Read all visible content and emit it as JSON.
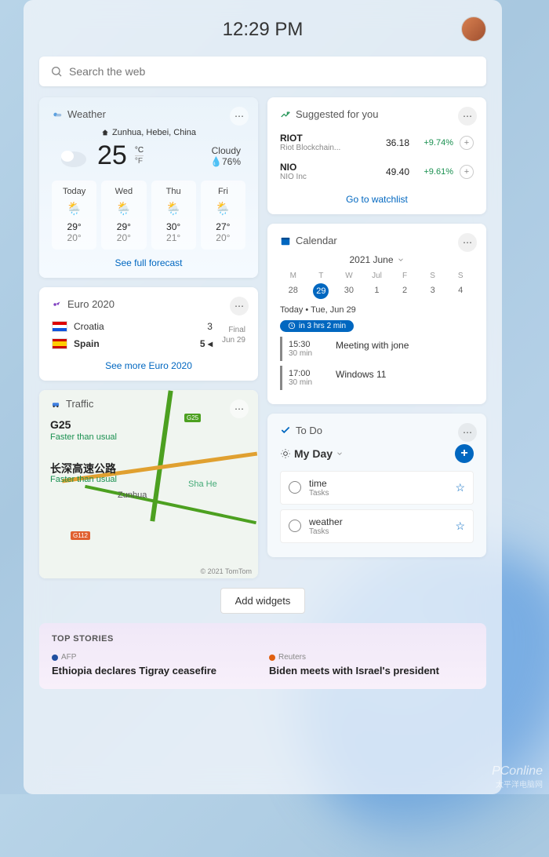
{
  "time": "12:29 PM",
  "search": {
    "placeholder": "Search the web"
  },
  "weather": {
    "title": "Weather",
    "location": "Zunhua, Hebei, China",
    "temp": "25",
    "unit_c": "°C",
    "unit_f": "°F",
    "condition": "Cloudy",
    "humidity": "76%",
    "forecast": [
      {
        "day": "Today",
        "hi": "29°",
        "lo": "20°"
      },
      {
        "day": "Wed",
        "hi": "29°",
        "lo": "20°"
      },
      {
        "day": "Thu",
        "hi": "30°",
        "lo": "21°"
      },
      {
        "day": "Fri",
        "hi": "27°",
        "lo": "20°"
      }
    ],
    "link": "See full forecast"
  },
  "suggested": {
    "title": "Suggested for you",
    "stocks": [
      {
        "sym": "RIOT",
        "name": "Riot Blockchain...",
        "price": "36.18",
        "chg": "+9.74%"
      },
      {
        "sym": "NIO",
        "name": "NIO Inc",
        "price": "49.40",
        "chg": "+9.61%"
      }
    ],
    "link": "Go to watchlist"
  },
  "euro": {
    "title": "Euro 2020",
    "team1": "Croatia",
    "score1": "3",
    "team2": "Spain",
    "score2": "5",
    "arrow": "◂",
    "status1": "Final",
    "status2": "Jun 29",
    "link": "See more Euro 2020"
  },
  "calendar": {
    "title": "Calendar",
    "month": "2021 June",
    "dow": [
      "M",
      "T",
      "W",
      "Jul",
      "F",
      "S",
      "S"
    ],
    "days": [
      "28",
      "29",
      "30",
      "1",
      "2",
      "3",
      "4"
    ],
    "selected": 1,
    "today": "Today • Tue, Jun 29",
    "pill": "in 3 hrs 2 min",
    "events": [
      {
        "time": "15:30",
        "dur": "30 min",
        "title": "Meeting with jone"
      },
      {
        "time": "17:00",
        "dur": "30 min",
        "title": "Windows 11"
      }
    ]
  },
  "traffic": {
    "title": "Traffic",
    "label1": "G25",
    "sub1": "Faster than usual",
    "label2": "长深高速公路",
    "sub2": "Faster than usual",
    "city": "Zunhua",
    "city2": "Sha He",
    "badge1": "G112",
    "badge2": "G25",
    "copy": "© 2021 TomTom"
  },
  "todo": {
    "title": "To Do",
    "myday": "My Day",
    "items": [
      {
        "title": "time",
        "sub": "Tasks"
      },
      {
        "title": "weather",
        "sub": "Tasks"
      }
    ]
  },
  "addwidget": "Add widgets",
  "stories": {
    "title": "TOP STORIES",
    "items": [
      {
        "src": "AFP",
        "head": "Ethiopia declares Tigray ceasefire"
      },
      {
        "src": "Reuters",
        "head": "Biden meets with Israel's president"
      }
    ]
  },
  "watermark": "PConline",
  "watermark2": "太平洋电脑网"
}
